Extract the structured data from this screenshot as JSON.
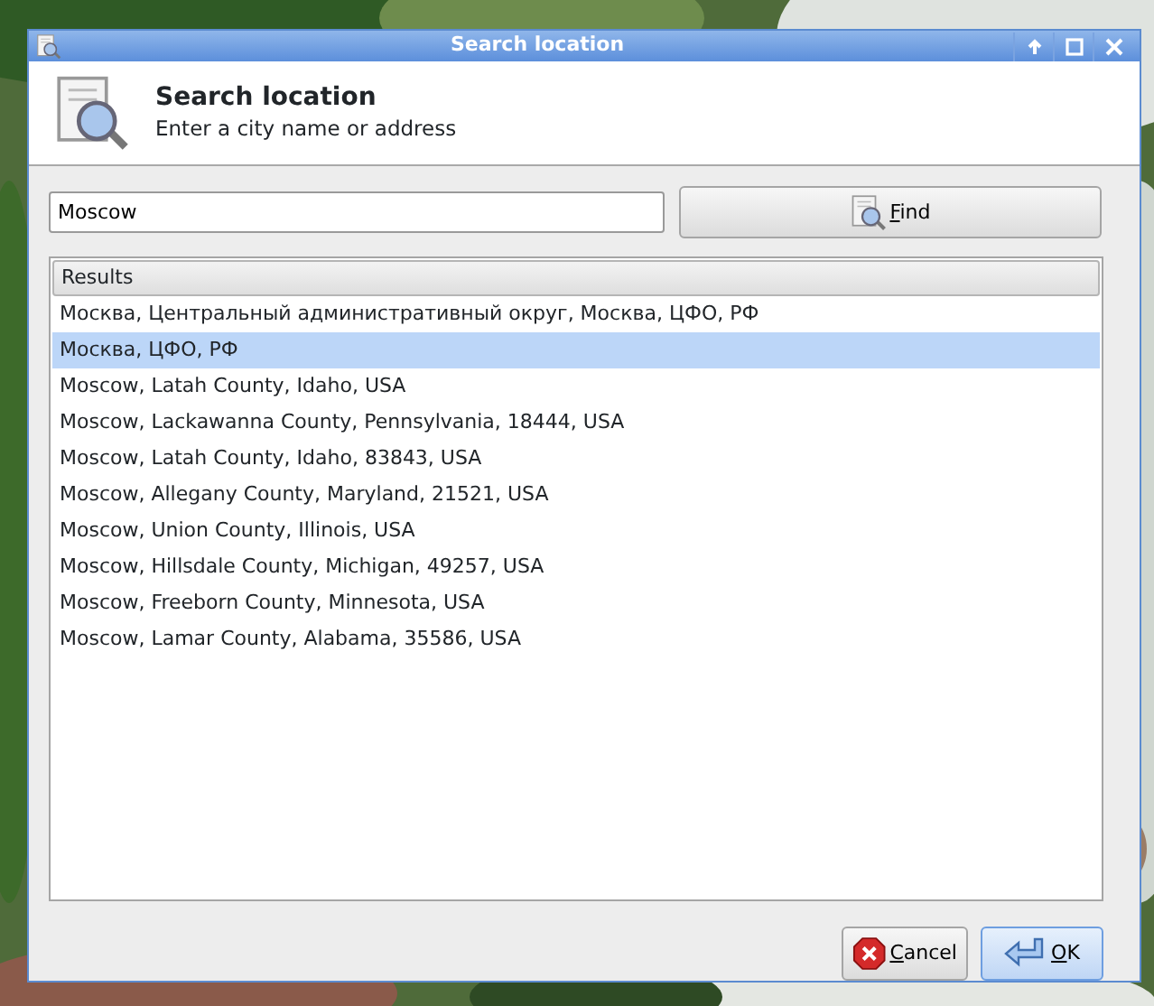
{
  "window": {
    "title": "Search location"
  },
  "header": {
    "title": "Search location",
    "subtitle": "Enter a city name or address"
  },
  "search": {
    "value": "Moscow"
  },
  "find_button": {
    "label": "Find"
  },
  "results": {
    "column": "Results",
    "rows": [
      {
        "text": "Москва, Центральный административный округ, Москва, ЦФО, РФ",
        "selected": false
      },
      {
        "text": "Москва, ЦФО, РФ",
        "selected": true
      },
      {
        "text": "Moscow, Latah County, Idaho, USA",
        "selected": false
      },
      {
        "text": "Moscow, Lackawanna County, Pennsylvania, 18444, USA",
        "selected": false
      },
      {
        "text": "Moscow, Latah County, Idaho, 83843, USA",
        "selected": false
      },
      {
        "text": "Moscow, Allegany County, Maryland, 21521, USA",
        "selected": false
      },
      {
        "text": "Moscow, Union County, Illinois, USA",
        "selected": false
      },
      {
        "text": "Moscow, Hillsdale County, Michigan, 49257, USA",
        "selected": false
      },
      {
        "text": "Moscow, Freeborn County, Minnesota, USA",
        "selected": false
      },
      {
        "text": "Moscow, Lamar County, Alabama, 35586, USA",
        "selected": false
      }
    ]
  },
  "buttons": [
    {
      "label": "Cancel",
      "kind": "cancel",
      "default": false
    },
    {
      "label": "OK",
      "kind": "ok",
      "default": true
    }
  ]
}
